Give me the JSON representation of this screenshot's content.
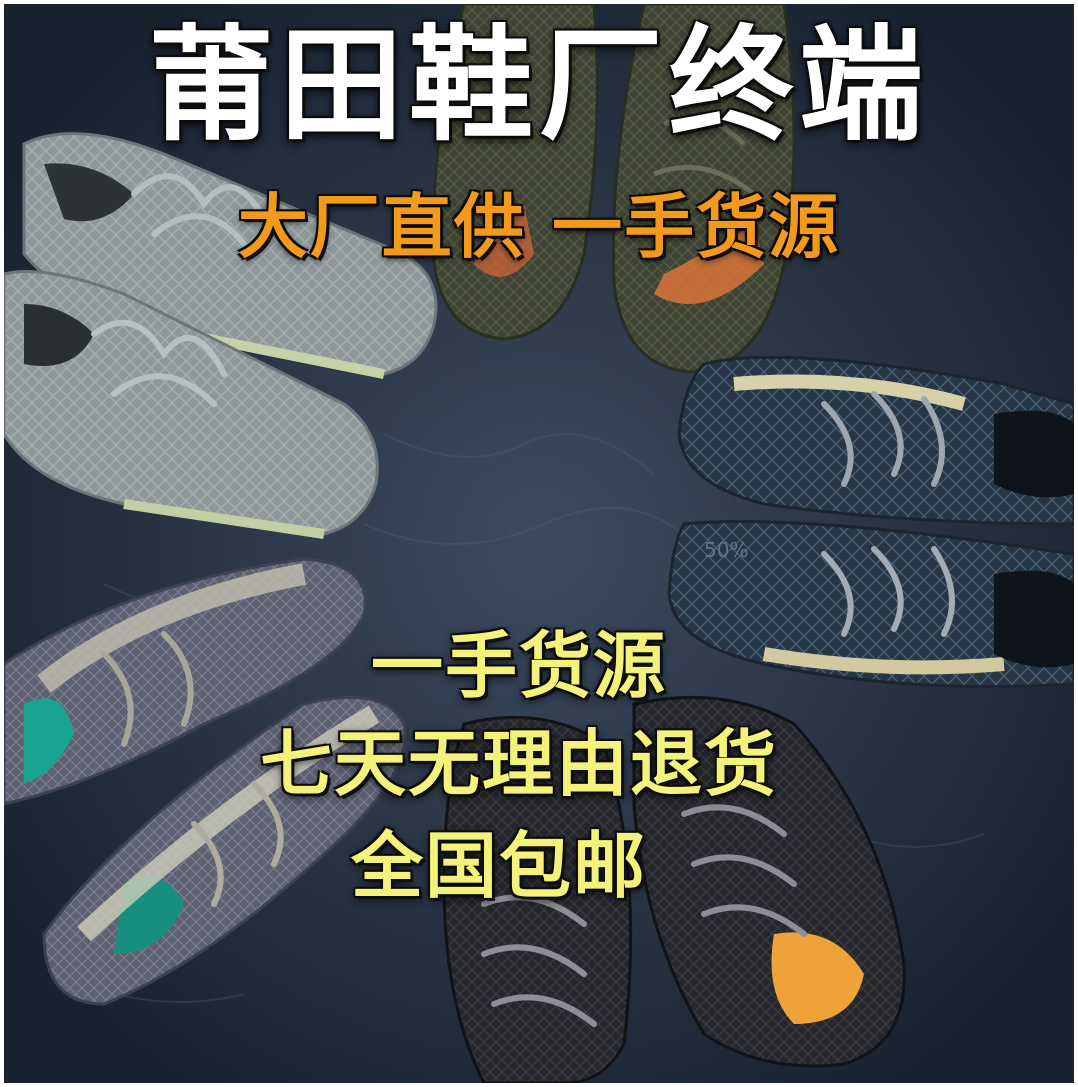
{
  "ad": {
    "headline": "莆田鞋厂终端",
    "subhead": "大厂直供 一手货源",
    "promo_lines": [
      "一手货源",
      "七天无理由退货",
      "全国包邮"
    ]
  },
  "photo": {
    "subject": "sneakers-arranged-in-circle",
    "background_color": "#26303f",
    "shoe_colors": [
      "#8e9699",
      "#3e4233",
      "#2a3a4a",
      "#7d7f87",
      "#2a2b30"
    ],
    "accent_colors": [
      "#d9743a",
      "#19a391",
      "#f0a23a"
    ],
    "label": "50%"
  }
}
